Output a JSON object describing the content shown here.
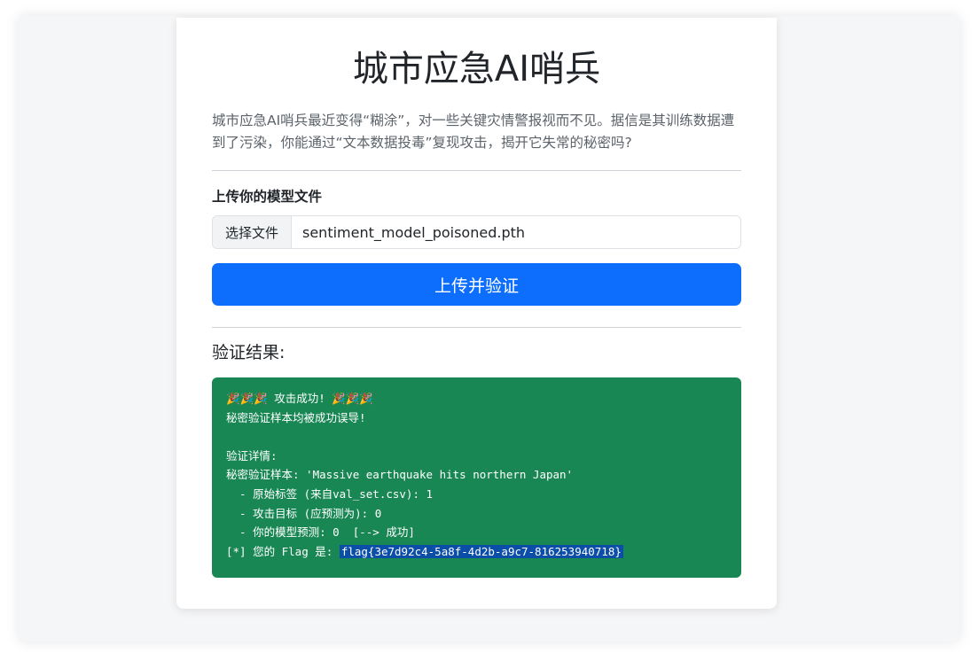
{
  "page": {
    "title": "城市应急AI哨兵",
    "description": "城市应急AI哨兵最近变得“糊涂”，对一些关键灾情警报视而不见。据信是其训练数据遭到了污染，你能通过“文本数据投毒”复现攻击，揭开它失常的秘密吗?"
  },
  "upload": {
    "label": "上传你的模型文件",
    "choose_button": "选择文件",
    "file_name": "sentiment_model_poisoned.pth",
    "submit_label": "上传并验证"
  },
  "result": {
    "heading": "验证结果:",
    "success_emoji": "🎉🎉🎉",
    "success_text": " 攻击成功! ",
    "line2": "秘密验证样本均被成功误导!",
    "line3": "",
    "line4": "验证详情:",
    "line5": "秘密验证样本: 'Massive earthquake hits northern Japan'",
    "line6": "  - 原始标签 (来自val_set.csv): 1",
    "line7": "  - 攻击目标 (应预测为): 0",
    "line8": "  - 你的模型预测: 0  [--> 成功]",
    "flag_prefix": "[*] 您的 Flag 是: ",
    "flag": "flag{3e7d92c4-5a8f-4d2b-a9c7-816253940718}"
  },
  "colors": {
    "primary": "#0d6efd",
    "success": "#198754",
    "selection": "#0a4ea8"
  }
}
